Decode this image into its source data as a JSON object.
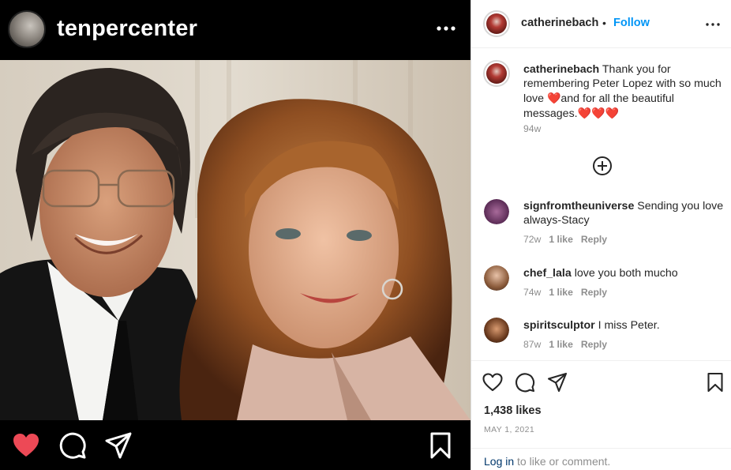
{
  "embedded_post": {
    "username": "tenpercenter",
    "icons": [
      "more-icon",
      "heart-filled-icon",
      "comment-icon",
      "share-icon",
      "bookmark-icon"
    ]
  },
  "post": {
    "author": "catherinebach",
    "separator": "•",
    "follow_label": "Follow",
    "caption": {
      "username": "catherinebach",
      "text_part1": "Thank you for remembering Peter Lopez with so much love ",
      "heart1": "❤️",
      "text_part2": "and for all the beautiful messages.",
      "hearts2": "❤️❤️❤️",
      "age": "94w"
    },
    "load_more_icon": "plus-circle-icon",
    "comments": [
      {
        "username": "signfromtheuniverse",
        "text": "Sending you love always-Stacy",
        "age": "72w",
        "likes": "1 like",
        "reply": "Reply"
      },
      {
        "username": "chef_lala",
        "text": "love you both mucho",
        "age": "74w",
        "likes": "1 like",
        "reply": "Reply"
      },
      {
        "username": "spiritsculptor",
        "text": "I miss Peter.",
        "age": "87w",
        "likes": "1 like",
        "reply": "Reply"
      }
    ],
    "likes": "1,438 likes",
    "date": "MAY 1, 2021",
    "login": {
      "link": "Log in",
      "rest": " to like or comment."
    }
  },
  "colors": {
    "accent": "#0095f6",
    "heart": "#ed4956",
    "text": "#262626",
    "muted": "#8e8e8e"
  }
}
